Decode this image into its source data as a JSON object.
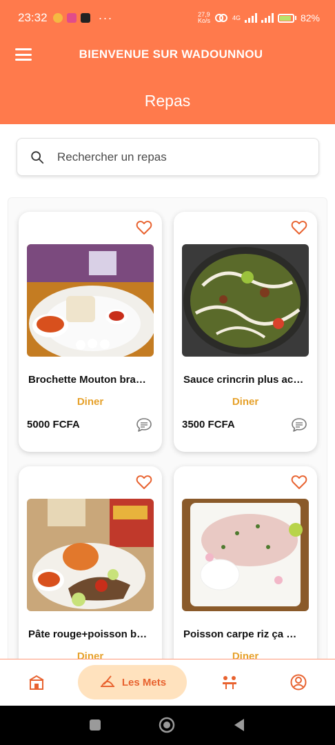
{
  "status": {
    "time": "23:32",
    "more": "···",
    "speed_value": "27,9",
    "speed_unit": "Ko/s",
    "network": "4G",
    "battery": "82%",
    "battery_level": 0.82
  },
  "header": {
    "app_title": "BIENVENUE SUR WADOUNNOU",
    "page_title": "Repas"
  },
  "search": {
    "placeholder": "Rechercher un repas"
  },
  "meals": [
    {
      "name": "Brochette Mouton bra…",
      "category": "Diner",
      "price": "5000 FCFA"
    },
    {
      "name": "Sauce crincrin plus ac…",
      "category": "Diner",
      "price": "3500 FCFA"
    },
    {
      "name": "Pâte rouge+poisson b…",
      "category": "Diner",
      "price": ""
    },
    {
      "name": "Poisson carpe riz  ça …",
      "category": "Diner",
      "price": ""
    }
  ],
  "nav": {
    "active_label": "Les Mets",
    "icons": [
      "restaurant-icon",
      "dish-icon",
      "dining-table-icon",
      "profile-icon"
    ]
  },
  "colors": {
    "brand": "#FF7A4C",
    "accent": "#E8622F",
    "category": "#E6A12A",
    "nav_active_bg": "#FFE2BE"
  }
}
